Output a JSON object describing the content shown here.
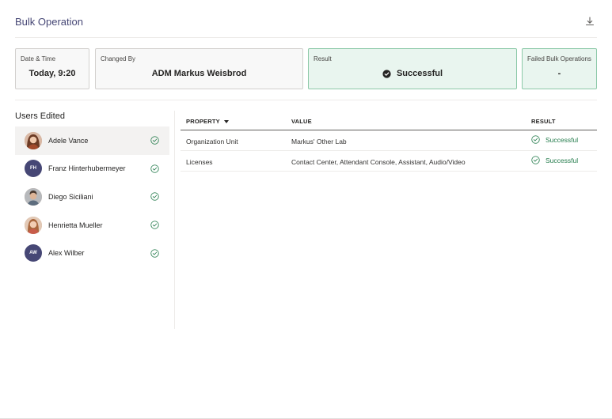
{
  "header": {
    "title": "Bulk Operation",
    "download_icon": "download-icon"
  },
  "cards": {
    "date_time": {
      "label": "Date & Time",
      "value": "Today, 9:20"
    },
    "changed_by": {
      "label": "Changed By",
      "value": "ADM Markus Weisbrod"
    },
    "result": {
      "label": "Result",
      "value": "Successful",
      "icon": "check-circle-filled-icon"
    },
    "failed": {
      "label": "Failed Bulk Operations",
      "value": "-"
    }
  },
  "colors": {
    "accent": "#464775",
    "success": "#237b4b",
    "success_bg": "#e9f5ef",
    "success_border": "#8cc9a8"
  },
  "users": {
    "title": "Users Edited",
    "items": [
      {
        "name": "Adele Vance",
        "avatar": "photo",
        "initials": "",
        "selected": true,
        "status_icon": "check-circle-icon"
      },
      {
        "name": "Franz Hinterhubermeyer",
        "avatar": "initials",
        "initials": "FH",
        "selected": false,
        "status_icon": "check-circle-icon"
      },
      {
        "name": "Diego Siciliani",
        "avatar": "photo",
        "initials": "",
        "selected": false,
        "status_icon": "check-circle-icon"
      },
      {
        "name": "Henrietta Mueller",
        "avatar": "photo",
        "initials": "",
        "selected": false,
        "status_icon": "check-circle-icon"
      },
      {
        "name": "Alex Wilber",
        "avatar": "initials",
        "initials": "AW",
        "selected": false,
        "status_icon": "check-circle-icon"
      }
    ]
  },
  "table": {
    "headers": {
      "property": "PROPERTY",
      "value": "VALUE",
      "result": "RESULT"
    },
    "rows": [
      {
        "property": "Organization Unit",
        "value": "Markus' Other Lab",
        "result": "Successful"
      },
      {
        "property": "Licenses",
        "value": "Contact Center, Attendant Console, Assistant, Audio/Video",
        "result": "Successful"
      }
    ]
  }
}
